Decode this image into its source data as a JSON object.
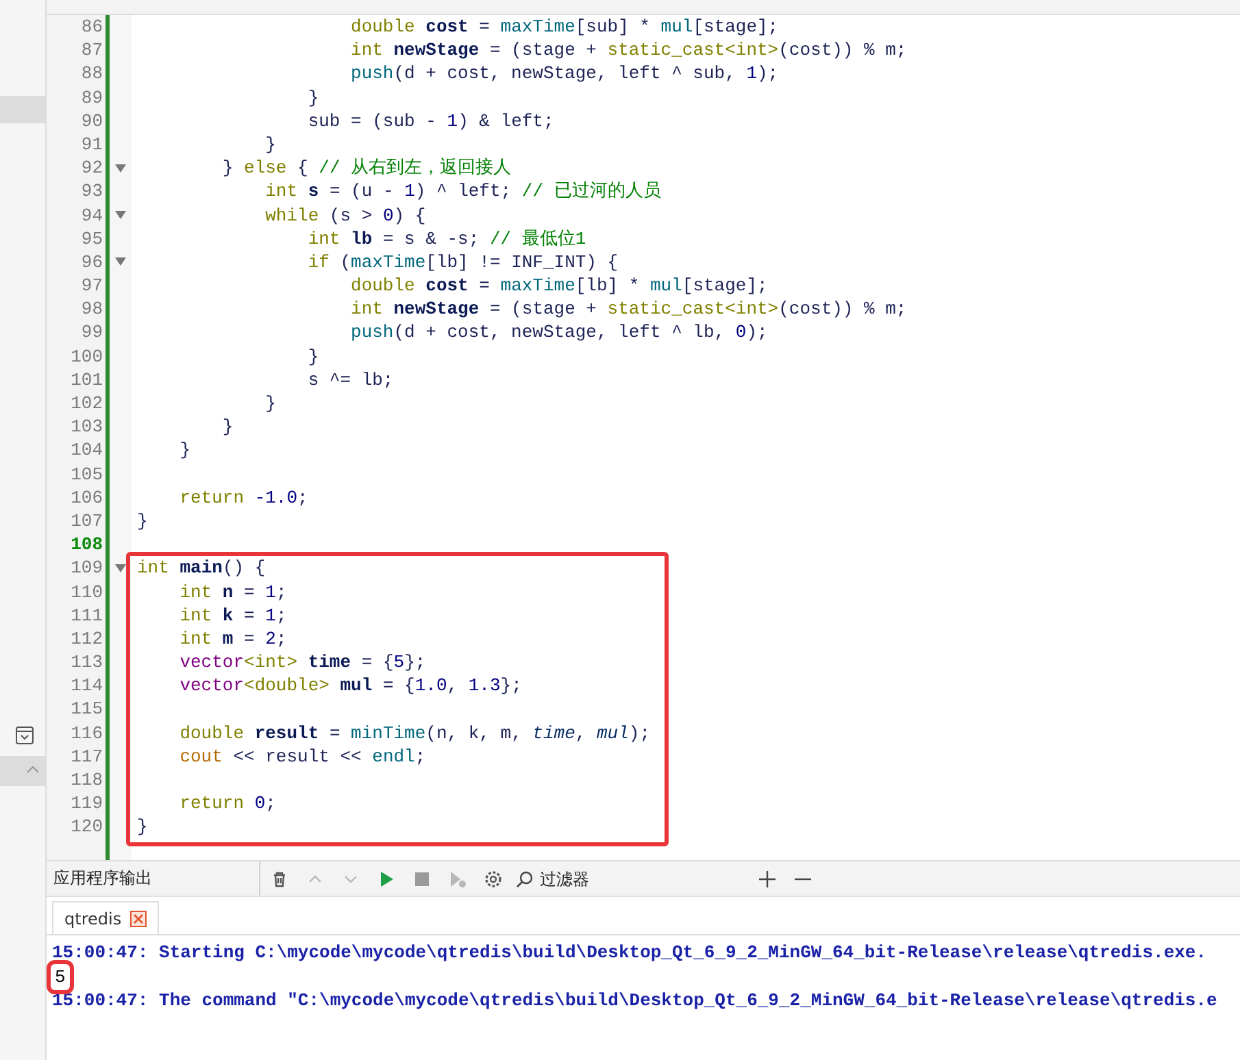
{
  "editor": {
    "lines": [
      {
        "number": "86",
        "fold": false,
        "current": false,
        "tokens": [
          {
            "kind": "keyword",
            "text": "                    double "
          },
          {
            "kind": "decl",
            "text": "cost"
          },
          {
            "kind": "plain",
            "text": " = "
          },
          {
            "kind": "func",
            "text": "maxTime"
          },
          {
            "kind": "plain",
            "text": "[sub] * "
          },
          {
            "kind": "func",
            "text": "mul"
          },
          {
            "kind": "plain",
            "text": "[stage];"
          }
        ]
      },
      {
        "number": "87",
        "fold": false,
        "current": false,
        "tokens": [
          {
            "kind": "keyword",
            "text": "                    int "
          },
          {
            "kind": "decl",
            "text": "newStage"
          },
          {
            "kind": "plain",
            "text": " = (stage + "
          },
          {
            "kind": "keyword",
            "text": "static_cast<int>"
          },
          {
            "kind": "plain",
            "text": "(cost)) % m;"
          }
        ]
      },
      {
        "number": "88",
        "fold": false,
        "current": false,
        "tokens": [
          {
            "kind": "func",
            "text": "                    push"
          },
          {
            "kind": "plain",
            "text": "(d + cost, newStage, left ^ sub, "
          },
          {
            "kind": "number",
            "text": "1"
          },
          {
            "kind": "plain",
            "text": ");"
          }
        ]
      },
      {
        "number": "89",
        "fold": false,
        "current": false,
        "tokens": [
          {
            "kind": "plain",
            "text": "                }"
          }
        ]
      },
      {
        "number": "90",
        "fold": false,
        "current": false,
        "tokens": [
          {
            "kind": "plain",
            "text": "                sub = (sub - "
          },
          {
            "kind": "number",
            "text": "1"
          },
          {
            "kind": "plain",
            "text": ") & left;"
          }
        ]
      },
      {
        "number": "91",
        "fold": false,
        "current": false,
        "tokens": [
          {
            "kind": "plain",
            "text": "            }"
          }
        ]
      },
      {
        "number": "92",
        "fold": true,
        "current": false,
        "tokens": [
          {
            "kind": "plain",
            "text": "        } "
          },
          {
            "kind": "keyword",
            "text": "else"
          },
          {
            "kind": "plain",
            "text": " { "
          },
          {
            "kind": "comment",
            "text": "// 从右到左，返回接人"
          }
        ]
      },
      {
        "number": "93",
        "fold": false,
        "current": false,
        "tokens": [
          {
            "kind": "keyword",
            "text": "            int "
          },
          {
            "kind": "decl",
            "text": "s"
          },
          {
            "kind": "plain",
            "text": " = (u - "
          },
          {
            "kind": "number",
            "text": "1"
          },
          {
            "kind": "plain",
            "text": ") ^ left; "
          },
          {
            "kind": "comment",
            "text": "// 已过河的人员"
          }
        ]
      },
      {
        "number": "94",
        "fold": true,
        "current": false,
        "tokens": [
          {
            "kind": "keyword",
            "text": "            while"
          },
          {
            "kind": "plain",
            "text": " (s > "
          },
          {
            "kind": "number",
            "text": "0"
          },
          {
            "kind": "plain",
            "text": ") {"
          }
        ]
      },
      {
        "number": "95",
        "fold": false,
        "current": false,
        "tokens": [
          {
            "kind": "keyword",
            "text": "                int "
          },
          {
            "kind": "decl",
            "text": "lb"
          },
          {
            "kind": "plain",
            "text": " = s & -s; "
          },
          {
            "kind": "comment",
            "text": "// 最低位1"
          }
        ]
      },
      {
        "number": "96",
        "fold": true,
        "current": false,
        "tokens": [
          {
            "kind": "keyword",
            "text": "                if"
          },
          {
            "kind": "plain",
            "text": " ("
          },
          {
            "kind": "func",
            "text": "maxTime"
          },
          {
            "kind": "plain",
            "text": "[lb] != INF_INT) {"
          }
        ]
      },
      {
        "number": "97",
        "fold": false,
        "current": false,
        "tokens": [
          {
            "kind": "keyword",
            "text": "                    double "
          },
          {
            "kind": "decl",
            "text": "cost"
          },
          {
            "kind": "plain",
            "text": " = "
          },
          {
            "kind": "func",
            "text": "maxTime"
          },
          {
            "kind": "plain",
            "text": "[lb] * "
          },
          {
            "kind": "func",
            "text": "mul"
          },
          {
            "kind": "plain",
            "text": "[stage];"
          }
        ]
      },
      {
        "number": "98",
        "fold": false,
        "current": false,
        "tokens": [
          {
            "kind": "keyword",
            "text": "                    int "
          },
          {
            "kind": "decl",
            "text": "newStage"
          },
          {
            "kind": "plain",
            "text": " = (stage + "
          },
          {
            "kind": "keyword",
            "text": "static_cast<int>"
          },
          {
            "kind": "plain",
            "text": "(cost)) % m;"
          }
        ]
      },
      {
        "number": "99",
        "fold": false,
        "current": false,
        "tokens": [
          {
            "kind": "func",
            "text": "                    push"
          },
          {
            "kind": "plain",
            "text": "(d + cost, newStage, left ^ lb, "
          },
          {
            "kind": "number",
            "text": "0"
          },
          {
            "kind": "plain",
            "text": ");"
          }
        ]
      },
      {
        "number": "100",
        "fold": false,
        "current": false,
        "tokens": [
          {
            "kind": "plain",
            "text": "                }"
          }
        ]
      },
      {
        "number": "101",
        "fold": false,
        "current": false,
        "tokens": [
          {
            "kind": "plain",
            "text": "                s ^= lb;"
          }
        ]
      },
      {
        "number": "102",
        "fold": false,
        "current": false,
        "tokens": [
          {
            "kind": "plain",
            "text": "            }"
          }
        ]
      },
      {
        "number": "103",
        "fold": false,
        "current": false,
        "tokens": [
          {
            "kind": "plain",
            "text": "        }"
          }
        ]
      },
      {
        "number": "104",
        "fold": false,
        "current": false,
        "tokens": [
          {
            "kind": "plain",
            "text": "    }"
          }
        ]
      },
      {
        "number": "105",
        "fold": false,
        "current": false
      },
      {
        "number": "106",
        "fold": false,
        "current": false,
        "tokens": [
          {
            "kind": "keyword",
            "text": "    return "
          },
          {
            "kind": "number",
            "text": "-1.0"
          },
          {
            "kind": "plain",
            "text": ";"
          }
        ]
      },
      {
        "number": "107",
        "fold": false,
        "current": false,
        "tokens": [
          {
            "kind": "plain",
            "text": "}"
          }
        ]
      },
      {
        "number": "108",
        "fold": false,
        "current": true
      }
    ],
    "highlight_box": {
      "lines": [
        {
          "number": "109",
          "fold": true,
          "current": false,
          "tokens": [
            {
              "kind": "keyword",
              "text": "int "
            },
            {
              "kind": "decl",
              "text": "main"
            },
            {
              "kind": "plain",
              "text": "() {"
            }
          ]
        },
        {
          "number": "110",
          "fold": false,
          "current": false,
          "tokens": [
            {
              "kind": "keyword",
              "text": "    int "
            },
            {
              "kind": "decl",
              "text": "n"
            },
            {
              "kind": "plain",
              "text": " = "
            },
            {
              "kind": "number",
              "text": "1"
            },
            {
              "kind": "plain",
              "text": ";"
            }
          ]
        },
        {
          "number": "111",
          "fold": false,
          "current": false,
          "tokens": [
            {
              "kind": "keyword",
              "text": "    int "
            },
            {
              "kind": "decl",
              "text": "k"
            },
            {
              "kind": "plain",
              "text": " = "
            },
            {
              "kind": "number",
              "text": "1"
            },
            {
              "kind": "plain",
              "text": ";"
            }
          ]
        },
        {
          "number": "112",
          "fold": false,
          "current": false,
          "tokens": [
            {
              "kind": "keyword",
              "text": "    int "
            },
            {
              "kind": "decl",
              "text": "m"
            },
            {
              "kind": "plain",
              "text": " = "
            },
            {
              "kind": "number",
              "text": "2"
            },
            {
              "kind": "plain",
              "text": ";"
            }
          ]
        },
        {
          "number": "113",
          "fold": false,
          "current": false,
          "tokens": [
            {
              "kind": "type",
              "text": "    vector"
            },
            {
              "kind": "keyword",
              "text": "<int> "
            },
            {
              "kind": "decl",
              "text": "time"
            },
            {
              "kind": "plain",
              "text": " = {"
            },
            {
              "kind": "number",
              "text": "5"
            },
            {
              "kind": "plain",
              "text": "};"
            }
          ]
        },
        {
          "number": "114",
          "fold": false,
          "current": false,
          "tokens": [
            {
              "kind": "type",
              "text": "    vector"
            },
            {
              "kind": "keyword",
              "text": "<double> "
            },
            {
              "kind": "decl",
              "text": "mul"
            },
            {
              "kind": "plain",
              "text": " = {"
            },
            {
              "kind": "number",
              "text": "1.0"
            },
            {
              "kind": "plain",
              "text": ", "
            },
            {
              "kind": "number",
              "text": "1.3"
            },
            {
              "kind": "plain",
              "text": "};"
            }
          ]
        },
        {
          "number": "115",
          "fold": false,
          "current": false
        },
        {
          "number": "116",
          "fold": false,
          "current": false,
          "tokens": [
            {
              "kind": "keyword",
              "text": "    double "
            },
            {
              "kind": "decl",
              "text": "result"
            },
            {
              "kind": "plain",
              "text": " = "
            },
            {
              "kind": "func",
              "text": "minTime"
            },
            {
              "kind": "plain",
              "text": "(n, k, m, "
            },
            {
              "kind": "param",
              "text": "time"
            },
            {
              "kind": "plain",
              "text": ", "
            },
            {
              "kind": "param",
              "text": "mul"
            },
            {
              "kind": "plain",
              "text": ");"
            }
          ]
        },
        {
          "number": "117",
          "fold": false,
          "current": false,
          "tokens": [
            {
              "kind": "stream",
              "text": "    cout"
            },
            {
              "kind": "plain",
              "text": " << result << "
            },
            {
              "kind": "func",
              "text": "endl"
            },
            {
              "kind": "plain",
              "text": ";"
            }
          ]
        },
        {
          "number": "118",
          "fold": false,
          "current": false
        },
        {
          "number": "119",
          "fold": false,
          "current": false,
          "tokens": [
            {
              "kind": "keyword",
              "text": "    return "
            },
            {
              "kind": "number",
              "text": "0"
            },
            {
              "kind": "plain",
              "text": ";"
            }
          ]
        },
        {
          "number": "120",
          "fold": false,
          "current": false,
          "tokens": [
            {
              "kind": "plain",
              "text": "}"
            }
          ]
        }
      ]
    }
  },
  "output_panel": {
    "title": "应用程序输出",
    "tools": [
      {
        "kind": "clear",
        "disabled": false
      },
      {
        "kind": "prev",
        "disabled": true
      },
      {
        "kind": "next",
        "disabled": true
      },
      {
        "kind": "run",
        "disabled": false
      },
      {
        "kind": "stop",
        "disabled": true
      },
      {
        "kind": "debug",
        "disabled": true
      },
      {
        "kind": "settings",
        "disabled": false
      }
    ],
    "filter": {
      "placeholder": "过滤器"
    },
    "tabs": [
      {
        "label": "qtredis",
        "selected": true
      }
    ],
    "lines": [
      {
        "kind": "system",
        "highlighted": false,
        "text": "15:00:47: Starting C:\\mycode\\mycode\\qtredis\\build\\Desktop_Qt_6_9_2_MinGW_64_bit-Release\\release\\qtredis.exe."
      },
      {
        "kind": "stdout",
        "highlighted": true,
        "text": "5"
      },
      {
        "kind": "system",
        "highlighted": false,
        "text": "15:00:47: The command \"C:\\mycode\\mycode\\qtredis\\build\\Desktop_Qt_6_9_2_MinGW_64_bit-Release\\release\\qtredis.e"
      }
    ]
  }
}
